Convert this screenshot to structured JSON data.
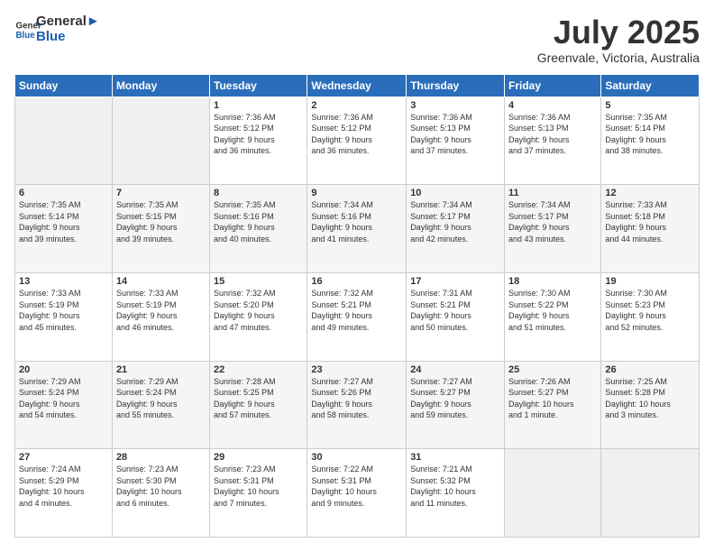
{
  "header": {
    "logo_line1": "General",
    "logo_line2": "Blue",
    "month_year": "July 2025",
    "location": "Greenvale, Victoria, Australia"
  },
  "weekdays": [
    "Sunday",
    "Monday",
    "Tuesday",
    "Wednesday",
    "Thursday",
    "Friday",
    "Saturday"
  ],
  "weeks": [
    [
      {
        "day": "",
        "info": ""
      },
      {
        "day": "",
        "info": ""
      },
      {
        "day": "1",
        "info": "Sunrise: 7:36 AM\nSunset: 5:12 PM\nDaylight: 9 hours\nand 36 minutes."
      },
      {
        "day": "2",
        "info": "Sunrise: 7:36 AM\nSunset: 5:12 PM\nDaylight: 9 hours\nand 36 minutes."
      },
      {
        "day": "3",
        "info": "Sunrise: 7:36 AM\nSunset: 5:13 PM\nDaylight: 9 hours\nand 37 minutes."
      },
      {
        "day": "4",
        "info": "Sunrise: 7:36 AM\nSunset: 5:13 PM\nDaylight: 9 hours\nand 37 minutes."
      },
      {
        "day": "5",
        "info": "Sunrise: 7:35 AM\nSunset: 5:14 PM\nDaylight: 9 hours\nand 38 minutes."
      }
    ],
    [
      {
        "day": "6",
        "info": "Sunrise: 7:35 AM\nSunset: 5:14 PM\nDaylight: 9 hours\nand 39 minutes."
      },
      {
        "day": "7",
        "info": "Sunrise: 7:35 AM\nSunset: 5:15 PM\nDaylight: 9 hours\nand 39 minutes."
      },
      {
        "day": "8",
        "info": "Sunrise: 7:35 AM\nSunset: 5:16 PM\nDaylight: 9 hours\nand 40 minutes."
      },
      {
        "day": "9",
        "info": "Sunrise: 7:34 AM\nSunset: 5:16 PM\nDaylight: 9 hours\nand 41 minutes."
      },
      {
        "day": "10",
        "info": "Sunrise: 7:34 AM\nSunset: 5:17 PM\nDaylight: 9 hours\nand 42 minutes."
      },
      {
        "day": "11",
        "info": "Sunrise: 7:34 AM\nSunset: 5:17 PM\nDaylight: 9 hours\nand 43 minutes."
      },
      {
        "day": "12",
        "info": "Sunrise: 7:33 AM\nSunset: 5:18 PM\nDaylight: 9 hours\nand 44 minutes."
      }
    ],
    [
      {
        "day": "13",
        "info": "Sunrise: 7:33 AM\nSunset: 5:19 PM\nDaylight: 9 hours\nand 45 minutes."
      },
      {
        "day": "14",
        "info": "Sunrise: 7:33 AM\nSunset: 5:19 PM\nDaylight: 9 hours\nand 46 minutes."
      },
      {
        "day": "15",
        "info": "Sunrise: 7:32 AM\nSunset: 5:20 PM\nDaylight: 9 hours\nand 47 minutes."
      },
      {
        "day": "16",
        "info": "Sunrise: 7:32 AM\nSunset: 5:21 PM\nDaylight: 9 hours\nand 49 minutes."
      },
      {
        "day": "17",
        "info": "Sunrise: 7:31 AM\nSunset: 5:21 PM\nDaylight: 9 hours\nand 50 minutes."
      },
      {
        "day": "18",
        "info": "Sunrise: 7:30 AM\nSunset: 5:22 PM\nDaylight: 9 hours\nand 51 minutes."
      },
      {
        "day": "19",
        "info": "Sunrise: 7:30 AM\nSunset: 5:23 PM\nDaylight: 9 hours\nand 52 minutes."
      }
    ],
    [
      {
        "day": "20",
        "info": "Sunrise: 7:29 AM\nSunset: 5:24 PM\nDaylight: 9 hours\nand 54 minutes."
      },
      {
        "day": "21",
        "info": "Sunrise: 7:29 AM\nSunset: 5:24 PM\nDaylight: 9 hours\nand 55 minutes."
      },
      {
        "day": "22",
        "info": "Sunrise: 7:28 AM\nSunset: 5:25 PM\nDaylight: 9 hours\nand 57 minutes."
      },
      {
        "day": "23",
        "info": "Sunrise: 7:27 AM\nSunset: 5:26 PM\nDaylight: 9 hours\nand 58 minutes."
      },
      {
        "day": "24",
        "info": "Sunrise: 7:27 AM\nSunset: 5:27 PM\nDaylight: 9 hours\nand 59 minutes."
      },
      {
        "day": "25",
        "info": "Sunrise: 7:26 AM\nSunset: 5:27 PM\nDaylight: 10 hours\nand 1 minute."
      },
      {
        "day": "26",
        "info": "Sunrise: 7:25 AM\nSunset: 5:28 PM\nDaylight: 10 hours\nand 3 minutes."
      }
    ],
    [
      {
        "day": "27",
        "info": "Sunrise: 7:24 AM\nSunset: 5:29 PM\nDaylight: 10 hours\nand 4 minutes."
      },
      {
        "day": "28",
        "info": "Sunrise: 7:23 AM\nSunset: 5:30 PM\nDaylight: 10 hours\nand 6 minutes."
      },
      {
        "day": "29",
        "info": "Sunrise: 7:23 AM\nSunset: 5:31 PM\nDaylight: 10 hours\nand 7 minutes."
      },
      {
        "day": "30",
        "info": "Sunrise: 7:22 AM\nSunset: 5:31 PM\nDaylight: 10 hours\nand 9 minutes."
      },
      {
        "day": "31",
        "info": "Sunrise: 7:21 AM\nSunset: 5:32 PM\nDaylight: 10 hours\nand 11 minutes."
      },
      {
        "day": "",
        "info": ""
      },
      {
        "day": "",
        "info": ""
      }
    ]
  ]
}
